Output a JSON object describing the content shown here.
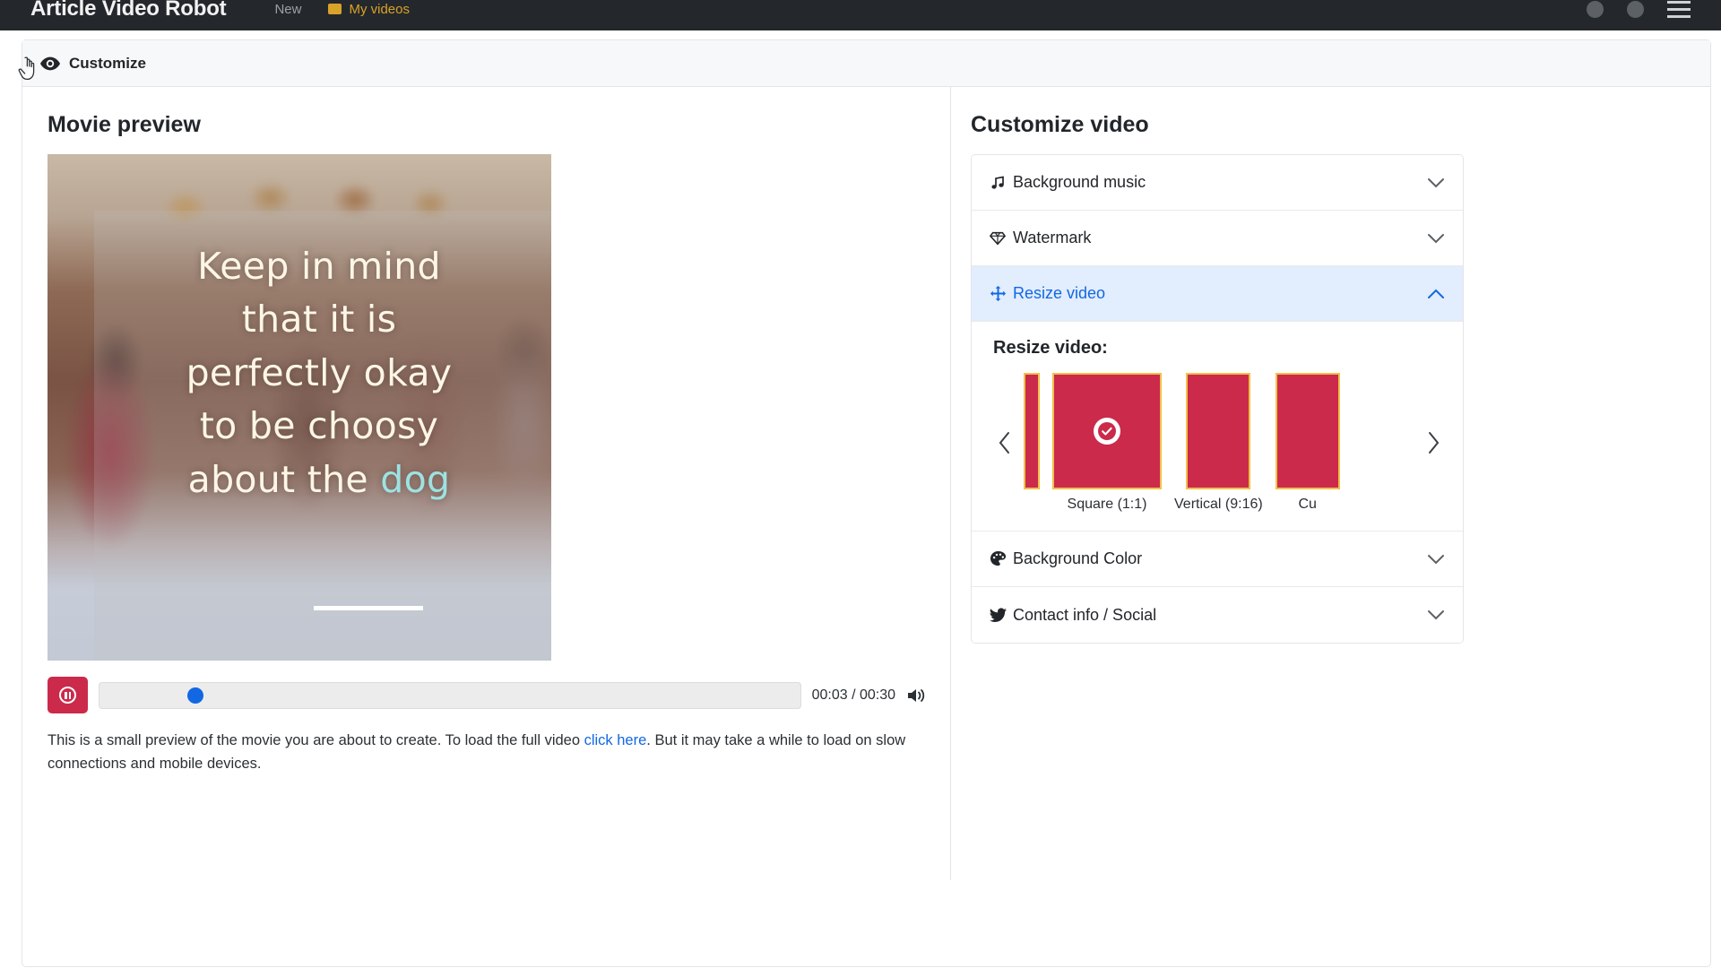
{
  "navbar": {
    "brand": "Article Video Robot",
    "links": [
      {
        "label": "New",
        "icon": "new-icon",
        "accent": false
      },
      {
        "label": "My videos",
        "icon": "folder-icon",
        "accent": true
      }
    ],
    "right_icons": [
      "help-circle-icon",
      "user-circle-icon",
      "menu-icon"
    ]
  },
  "card": {
    "header": {
      "title": "Customize",
      "icon": "eye-icon"
    }
  },
  "preview": {
    "title": "Movie preview",
    "caption_lines": [
      "Keep in mind",
      "that it is",
      "perfectly okay",
      "to be choosy",
      "about the "
    ],
    "caption_highlight": "dog",
    "player": {
      "state_icon": "pause-icon",
      "time": "00:03 / 00:30",
      "progress_percent": 12.5,
      "volume_icon": "volume-icon"
    },
    "note_before": "This is a small preview of the movie you are about to create. To load the full video ",
    "note_link": "click here",
    "note_after": ". But it may take a while to load on slow connections and mobile devices."
  },
  "customize": {
    "title": "Customize video",
    "accordion": [
      {
        "label": "Background music",
        "icon": "music-note-icon",
        "active": false,
        "chevron": "chevron-down-icon"
      },
      {
        "label": "Watermark",
        "icon": "gem-icon",
        "active": false,
        "chevron": "chevron-down-icon"
      },
      {
        "label": "Resize video",
        "icon": "move-arrows-icon",
        "active": true,
        "chevron": "chevron-up-icon"
      },
      {
        "label": "Background Color",
        "icon": "palette-icon",
        "active": false,
        "chevron": "chevron-down-icon"
      },
      {
        "label": "Contact info / Social",
        "icon": "twitter-bird-icon",
        "active": false,
        "chevron": "chevron-down-icon"
      }
    ],
    "resize": {
      "panel_title": "Resize video:",
      "prev_icon": "chevron-left-icon",
      "next_icon": "chevron-right-icon",
      "options": [
        {
          "label": "",
          "shape": "story",
          "selected": false
        },
        {
          "label": "Square (1:1)",
          "shape": "square",
          "selected": true
        },
        {
          "label": "Vertical (9:16)",
          "shape": "vertical",
          "selected": false
        },
        {
          "label": "Cu",
          "shape": "custom",
          "selected": false
        }
      ],
      "selected_badge_icon": "check-circle-icon"
    }
  },
  "colors": {
    "brand_red": "#cb2a4b",
    "accent_blue": "#1268e3",
    "thumb_border": "#f0c14b",
    "navbar_bg": "#24282c",
    "caption_highlight": "#9ee2e2"
  }
}
